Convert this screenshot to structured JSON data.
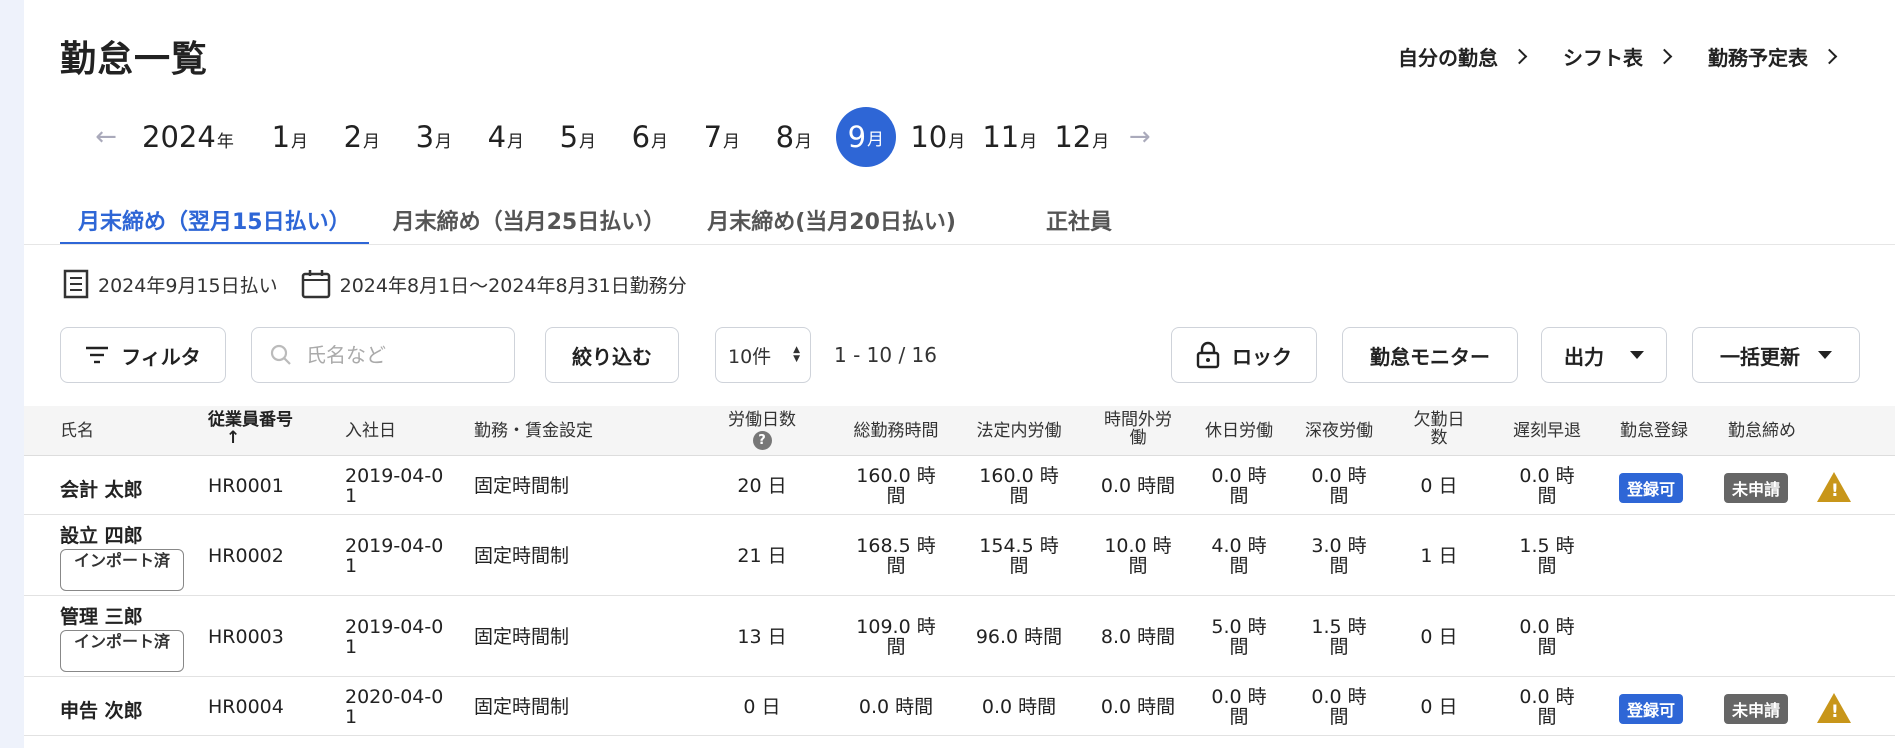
{
  "page": {
    "title": "勤怠一覧"
  },
  "toplinks": [
    "自分の勤怠",
    "シフト表",
    "勤務予定表"
  ],
  "months": {
    "year": "2024",
    "year_unit": "年",
    "month_unit": "月",
    "items": [
      "1",
      "2",
      "3",
      "4",
      "5",
      "6",
      "7",
      "8",
      "9",
      "10",
      "11",
      "12"
    ],
    "selected": "9"
  },
  "tabs": [
    "月末締め（翌月15日払い）",
    "月末締め（当月25日払い）",
    "月末締め(当月20日払い)",
    "正社員"
  ],
  "info": {
    "payday": "2024年9月15日払い",
    "period": "2024年8月1日〜2024年8月31日勤務分"
  },
  "toolbar": {
    "filter": "フィルタ",
    "search_placeholder": "氏名など",
    "narrow": "絞り込む",
    "per_page": "10件",
    "range": "1 - 10 / 16",
    "lock": "ロック",
    "monitor": "勤怠モニター",
    "output": "出力",
    "bulk_update": "一括更新"
  },
  "table": {
    "headers": {
      "name": "氏名",
      "emp_no": "従業員番号",
      "sort": "↑",
      "join": "入社日",
      "setting": "勤務・賃金設定",
      "workdays": "労働日数",
      "help": "?",
      "total": "総勤務時間",
      "legal": "法定内労働",
      "overtime": [
        "時間外労",
        "働"
      ],
      "holiday": "休日労働",
      "night": "深夜労働",
      "absence": [
        "欠勤日",
        "数"
      ],
      "late": "遅刻早退",
      "register": "勤怠登録",
      "closing": "勤怠締め"
    },
    "rows": [
      {
        "name": "会計 太郎",
        "import": "",
        "emp_no": "HR0001",
        "join": [
          "2019-04-0",
          "1"
        ],
        "setting": "固定時間制",
        "days": "20 日",
        "total": [
          "160.0 時",
          "間"
        ],
        "legal": [
          "160.0 時",
          "間"
        ],
        "overtime": [
          "0.0 時間",
          ""
        ],
        "holiday": [
          "0.0 時",
          "間"
        ],
        "night": [
          "0.0 時",
          "間"
        ],
        "absence": "0 日",
        "late": [
          "0.0 時",
          "間"
        ],
        "register": "登録可",
        "closing": "未申請",
        "warn": "!"
      },
      {
        "name": "設立 四郎",
        "import": "インポート済",
        "emp_no": "HR0002",
        "join": [
          "2019-04-0",
          "1"
        ],
        "setting": "固定時間制",
        "days": "21 日",
        "total": [
          "168.5 時",
          "間"
        ],
        "legal": [
          "154.5 時",
          "間"
        ],
        "overtime": [
          "10.0 時",
          "間"
        ],
        "holiday": [
          "4.0 時",
          "間"
        ],
        "night": [
          "3.0 時",
          "間"
        ],
        "absence": "1 日",
        "late": [
          "1.5 時",
          "間"
        ],
        "register": "",
        "closing": "",
        "warn": ""
      },
      {
        "name": "管理 三郎",
        "import": "インポート済",
        "emp_no": "HR0003",
        "join": [
          "2019-04-0",
          "1"
        ],
        "setting": "固定時間制",
        "days": "13 日",
        "total": [
          "109.0 時",
          "間"
        ],
        "legal": [
          "96.0 時間",
          ""
        ],
        "overtime": [
          "8.0 時間",
          ""
        ],
        "holiday": [
          "5.0 時",
          "間"
        ],
        "night": [
          "1.5 時",
          "間"
        ],
        "absence": "0 日",
        "late": [
          "0.0 時",
          "間"
        ],
        "register": "",
        "closing": "",
        "warn": ""
      },
      {
        "name": "申告 次郎",
        "import": "",
        "emp_no": "HR0004",
        "join": [
          "2020-04-0",
          "1"
        ],
        "setting": "固定時間制",
        "days": "0 日",
        "total": [
          "0.0 時間",
          ""
        ],
        "legal": [
          "0.0 時間",
          ""
        ],
        "overtime": [
          "0.0 時間",
          ""
        ],
        "holiday": [
          "0.0 時",
          "間"
        ],
        "night": [
          "0.0 時",
          "間"
        ],
        "absence": "0 日",
        "late": [
          "0.0 時",
          "間"
        ],
        "register": "登録可",
        "closing": "未申請",
        "warn": "!"
      }
    ]
  }
}
